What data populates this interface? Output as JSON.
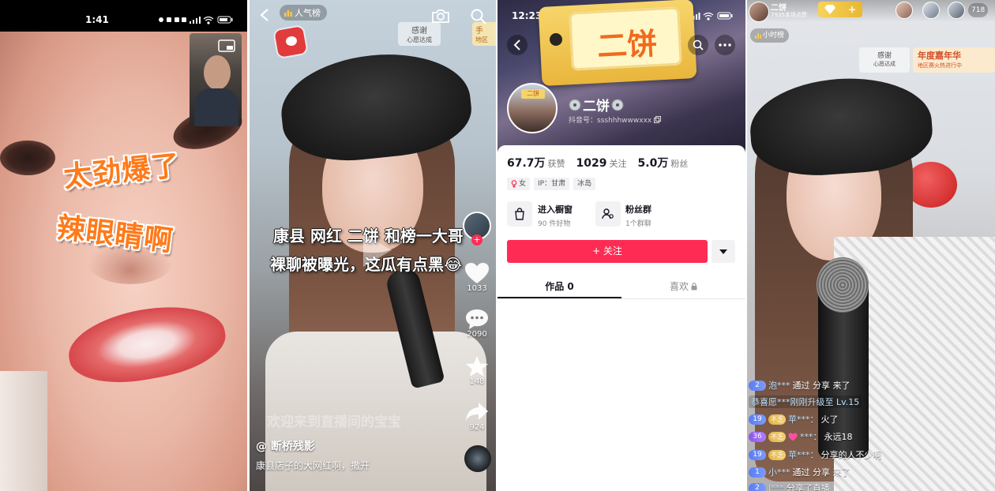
{
  "panel_call": {
    "status_time": "1:41",
    "caption_line1": "太劲爆了",
    "caption_line2": "辣眼睛啊"
  },
  "panel_video": {
    "rank_label": "人气榜",
    "thanks_title": "感谢",
    "thanks_sub": "心愿达成",
    "event_title": "手",
    "event_sub": "地区",
    "title_line1": "康县 网红 二饼 和榜一大哥",
    "title_line2": "裸聊被曝光，这瓜有点黑😂",
    "likes": "1033",
    "comments": "2090",
    "favorites": "148",
    "shares": "924",
    "overlay_text": "欢迎来到直播间的宝宝",
    "author": "@ 断桥残影",
    "description": "康县店子的大网红啊，撒开"
  },
  "panel_profile": {
    "status_time": "12:23",
    "banner_tag": "二饼",
    "avatar_label": "二饼",
    "display_name": "二饼",
    "douyin_id": "抖音号：ssshhhwwwxxx",
    "stats": [
      {
        "value": "67.7万",
        "label": "获赞"
      },
      {
        "value": "1029",
        "label": "关注"
      },
      {
        "value": "5.0万",
        "label": "粉丝"
      }
    ],
    "tags": [
      "女",
      "IP：甘肃",
      "冰岛"
    ],
    "shop": {
      "title": "进入橱窗",
      "sub": "90 件好物"
    },
    "fans_group": {
      "title": "粉丝群",
      "sub": "1个群聊"
    },
    "follow_label": "+ 关注",
    "tabs": [
      {
        "label": "作品 0"
      },
      {
        "label": "喜欢"
      }
    ],
    "colors": {
      "accent": "#fe2c55",
      "tag_text": "#f06a1f"
    }
  },
  "panel_live": {
    "host_name": "二饼",
    "host_likes": "7935本场点赞",
    "viewer_count": "718",
    "hour_rank": "小时榜",
    "thanks_title": "感谢",
    "thanks_sub": "心愿达成",
    "event_title": "年度嘉年华",
    "event_sub": "地区赛火热进行中",
    "chat": [
      {
        "level": "2",
        "name": "泡***",
        "text": "通过 分享 来了"
      },
      {
        "text": "恭喜愿***刚刚升级至 Lv.15"
      },
      {
        "level": "19",
        "badge": "不乏",
        "name": "苹***：",
        "text": "火了"
      },
      {
        "level": "36",
        "badge": "不乏",
        "name": "***：",
        "text": "永远18"
      },
      {
        "level": "19",
        "badge": "不乏",
        "name": "苹***：",
        "text": "分享的人不少啊"
      },
      {
        "level": "1",
        "name": "小***",
        "text": "通过 分享 来了"
      },
      {
        "level": "2",
        "name": "J***",
        "text": "分享了直播"
      }
    ]
  }
}
